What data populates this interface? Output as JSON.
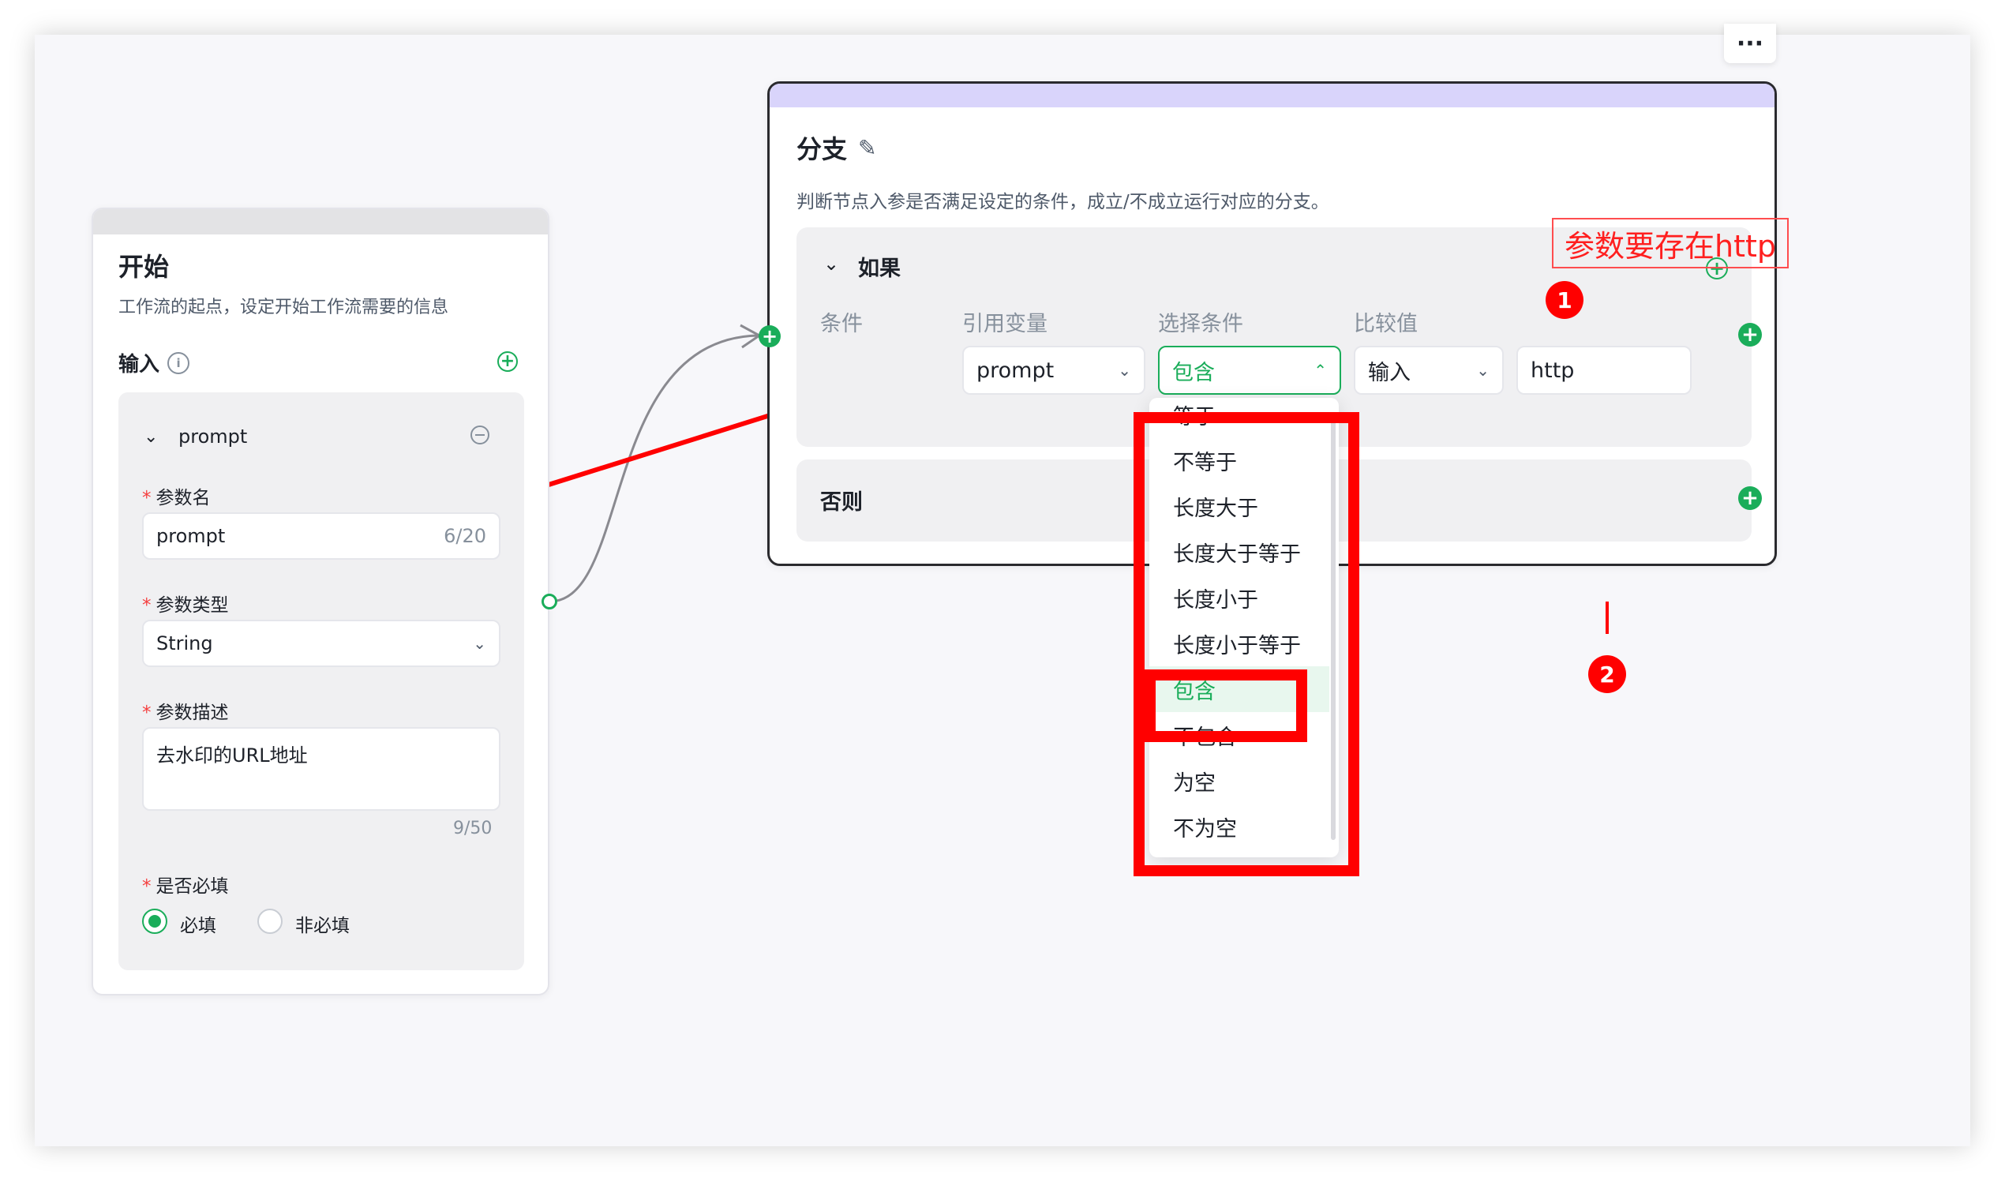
{
  "start_node": {
    "title": "开始",
    "description": "工作流的起点，设定开始工作流需要的信息",
    "input_label": "输入",
    "param": {
      "name": "prompt",
      "name_label": "参数名",
      "name_value": "prompt",
      "name_counter": "6/20",
      "type_label": "参数类型",
      "type_value": "String",
      "desc_label": "参数描述",
      "desc_value": "去水印的URL地址",
      "desc_counter": "9/50",
      "required_label": "是否必填",
      "required_option": "必填",
      "optional_option": "非必填",
      "required_asterisk": "*"
    }
  },
  "branch_node": {
    "title": "分支",
    "description": "判断节点入参是否满足设定的条件，成立/不成立运行对应的分支。",
    "if_label": "如果",
    "else_label": "否则",
    "columns": {
      "condition": "条件",
      "variable": "引用变量",
      "operator": "选择条件",
      "compare": "比较值"
    },
    "row": {
      "variable": "prompt",
      "operator": "包含",
      "compare_type": "输入",
      "compare_value": "http"
    }
  },
  "dropdown": {
    "options": [
      "等于",
      "不等于",
      "长度大于",
      "长度大于等于",
      "长度小于",
      "长度小于等于",
      "包含",
      "不包含",
      "为空",
      "不为空"
    ],
    "selected": "包含"
  },
  "annotations": {
    "note": "参数要存在http",
    "badge_1": "1",
    "badge_2": "2"
  },
  "more_menu": "···",
  "colors": {
    "accent": "#1aad5a",
    "annotation": "#ff0000",
    "branch_header": "#d9d4fb"
  }
}
